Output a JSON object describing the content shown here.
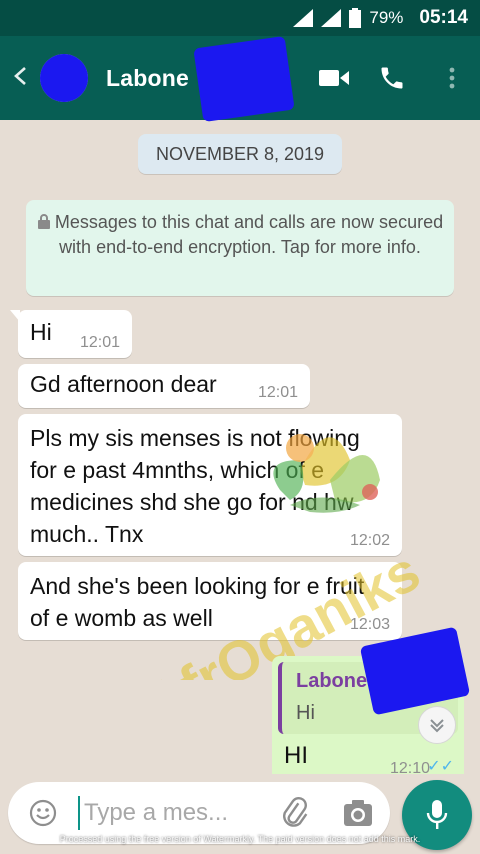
{
  "status_bar": {
    "battery": "79%",
    "time": "05:14"
  },
  "header": {
    "contact_name": "Labone",
    "back_icon": "arrow-left-icon",
    "video_icon": "videocam-icon",
    "call_icon": "phone-icon",
    "menu_icon": "more-vert-icon"
  },
  "chat": {
    "date": "NOVEMBER 8, 2019",
    "encryption_notice": "Messages to this chat and calls are now secured with end-to-end encryption. Tap for more info.",
    "messages": [
      {
        "text": "Hi",
        "time": "12:01"
      },
      {
        "text": "Gd afternoon dear",
        "time": "12:01"
      },
      {
        "text": "Pls my sis menses is not flowing for e past 4mnths, which of e medicines shd she go for nd hw much.. Tnx",
        "time": "12:02"
      },
      {
        "text": "And she's been looking for e fruit of e womb as well",
        "time": "12:03"
      }
    ],
    "outgoing": {
      "quoted_name": "Labone",
      "quoted_text": "Hi",
      "text": "HI",
      "time": "12:10"
    },
    "watermark": "AfrOganiks"
  },
  "input": {
    "placeholder": "Type a mes..."
  },
  "footer_note": "Processed using the free version of Watermarkly. The paid version does not add this mark.",
  "colors": {
    "toolbar": "#075e54",
    "status_bar": "#054d44",
    "accent": "#128c7e",
    "outgoing_bubble": "#dcf8c6",
    "quote_bar": "#7b3fa0"
  }
}
